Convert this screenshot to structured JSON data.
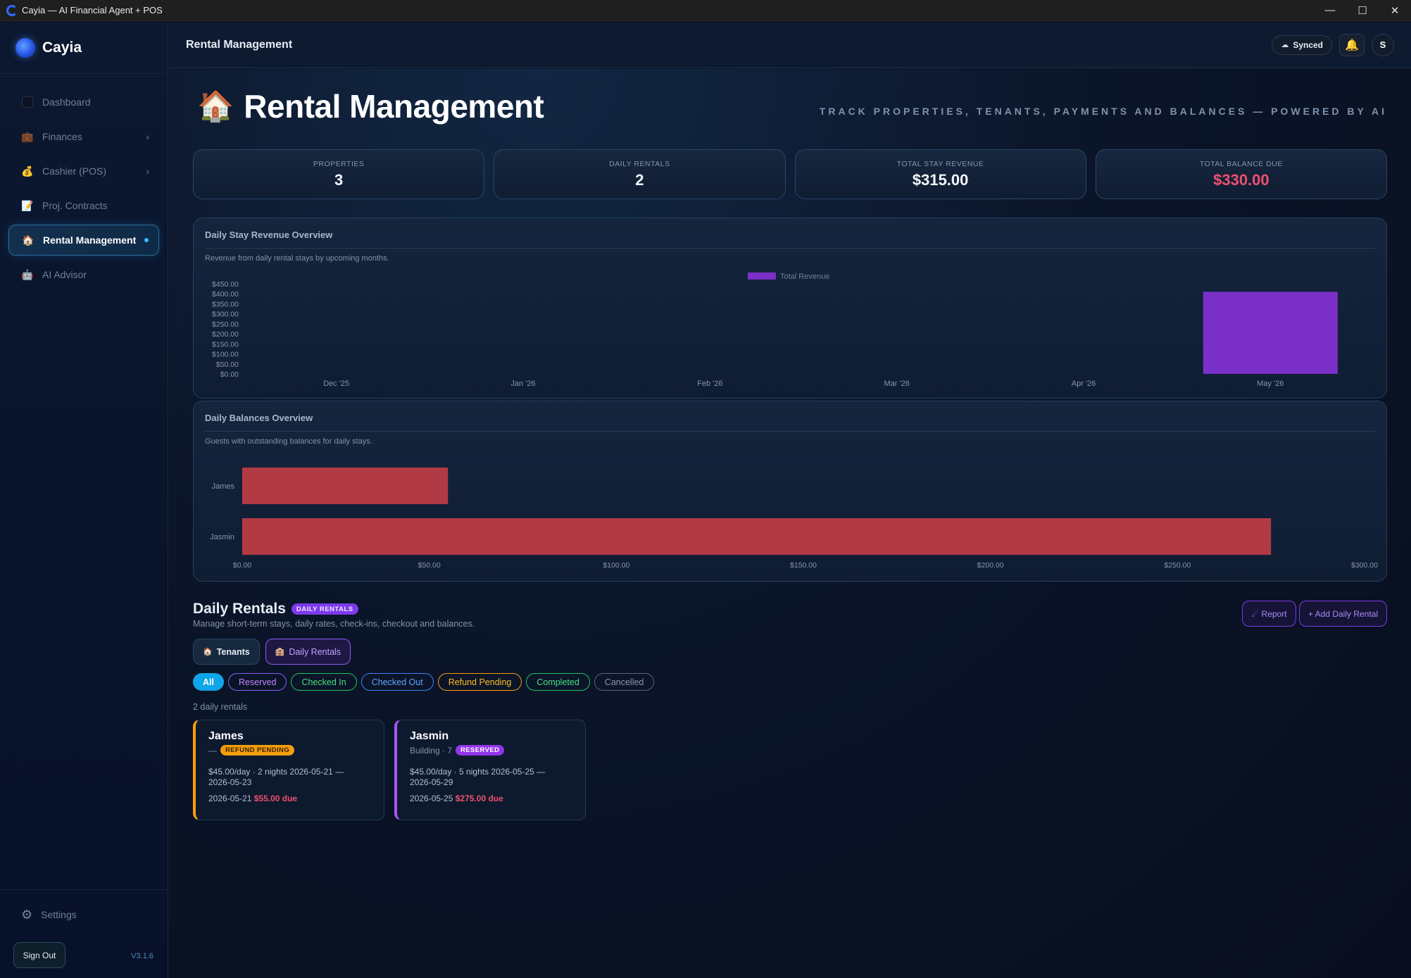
{
  "window": {
    "title": "Cayia — AI Financial Agent + POS",
    "minimize": "—",
    "maximize": "☐",
    "close": "✕"
  },
  "sidebar": {
    "brand": "Cayia",
    "items": [
      {
        "label": "Dashboard",
        "icon": "dashboard-icon"
      },
      {
        "label": "Finances",
        "icon": "briefcase-icon",
        "chevron": "›"
      },
      {
        "label": "Cashier (POS)",
        "icon": "money-bag-icon",
        "chevron": "›"
      },
      {
        "label": "Proj. Contracts",
        "icon": "document-icon"
      },
      {
        "label": "Rental Management",
        "icon": "house-icon",
        "active": true
      },
      {
        "label": "AI Advisor",
        "icon": "robot-icon"
      }
    ],
    "settings": "Settings",
    "sign_out": "Sign Out",
    "version": "V3.1.6"
  },
  "header": {
    "title": "Rental Management",
    "synced": "Synced",
    "avatar": "S"
  },
  "page": {
    "title": "Rental Management",
    "tagline": "TRACK PROPERTIES, TENANTS, PAYMENTS AND BALANCES — POWERED BY AI"
  },
  "stats": [
    {
      "label": "PROPERTIES",
      "value": "3"
    },
    {
      "label": "DAILY RENTALS",
      "value": "2"
    },
    {
      "label": "TOTAL STAY REVENUE",
      "value": "$315.00"
    },
    {
      "label": "TOTAL BALANCE DUE",
      "value": "$330.00",
      "status_color": "#f0506e"
    }
  ],
  "colors": {
    "revenue_bar": "#7a30c8",
    "balance_bar": "#b13a45",
    "accent": "#38bdf8",
    "danger": "#f0506e"
  },
  "chart_data": [
    {
      "type": "bar",
      "title": "Daily Stay Revenue Overview",
      "subtitle": "Revenue from daily rental stays by upcoming months.",
      "categories": [
        "Dec '25",
        "Jan '26",
        "Feb '26",
        "Mar '26",
        "Apr '26",
        "May '26"
      ],
      "series": [
        {
          "name": "Total Revenue",
          "values": [
            0,
            0,
            0,
            0,
            0,
            410
          ]
        }
      ],
      "yticks": [
        "$0.00",
        "$50.00",
        "$100.00",
        "$150.00",
        "$200.00",
        "$250.00",
        "$300.00",
        "$350.00",
        "$400.00",
        "$450.00"
      ],
      "ylim": [
        0,
        450
      ],
      "legend": "top-center",
      "grid": false
    },
    {
      "type": "bar",
      "orientation": "horizontal",
      "title": "Daily Balances Overview",
      "subtitle": "Guests with outstanding balances for daily stays.",
      "categories": [
        "James",
        "Jasmin"
      ],
      "values": [
        55,
        275
      ],
      "xticks": [
        "$0.00",
        "$50.00",
        "$100.00",
        "$150.00",
        "$200.00",
        "$250.00",
        "$300.00"
      ],
      "xlim": [
        0,
        300
      ],
      "grid": false
    }
  ],
  "daily_rentals": {
    "title": "Daily Rentals",
    "badge": "DAILY RENTALS",
    "subtitle": "Manage short-term stays, daily rates, check-ins, checkout and balances.",
    "report_button": "☄ Report",
    "add_button": "+ Add Daily Rental",
    "tabs": [
      {
        "label": "Tenants",
        "icon": "🏠"
      },
      {
        "label": "Daily Rentals",
        "icon": "🏨"
      }
    ],
    "filters": [
      "All",
      "Reserved",
      "Checked In",
      "Checked Out",
      "Refund Pending",
      "Completed",
      "Cancelled"
    ],
    "count": "2 daily rentals",
    "cards": [
      {
        "name": "James",
        "location": "—",
        "status": "REFUND PENDING",
        "details": "$45.00/day · 2 nights 2026-05-21 — 2026-05-23",
        "start": "2026-05-21",
        "due": "$55.00 due"
      },
      {
        "name": "Jasmin",
        "location": "Building · 7",
        "status": "RESERVED",
        "details": "$45.00/day · 5 nights 2026-05-25 — 2026-05-29",
        "start": "2026-05-25",
        "due": "$275.00 due"
      }
    ]
  }
}
